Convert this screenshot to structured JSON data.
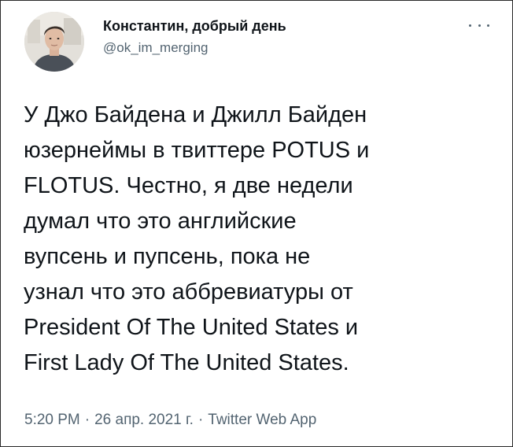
{
  "author": {
    "display_name": "Константин, добрый день",
    "handle": "@ok_im_merging"
  },
  "tweet": {
    "lines": [
      "У Джо Байдена и Джилл Байден",
      "юзернеймы в твиттере POTUS и",
      "FLOTUS. Честно, я две недели",
      "думал что это английские",
      "вупсень и пупсень, пока не",
      "узнал что это аббревиатуры от",
      "President Of The United States и",
      "First Lady Of The United States."
    ]
  },
  "meta": {
    "time": "5:20 PM",
    "separator": "·",
    "date": "26 апр. 2021 г.",
    "source": "Twitter Web App"
  },
  "icons": {
    "more": "more-horizontal-icon",
    "avatar": "avatar-photo"
  },
  "colors": {
    "text": "#0f1419",
    "secondary": "#536471",
    "background": "#ffffff"
  }
}
